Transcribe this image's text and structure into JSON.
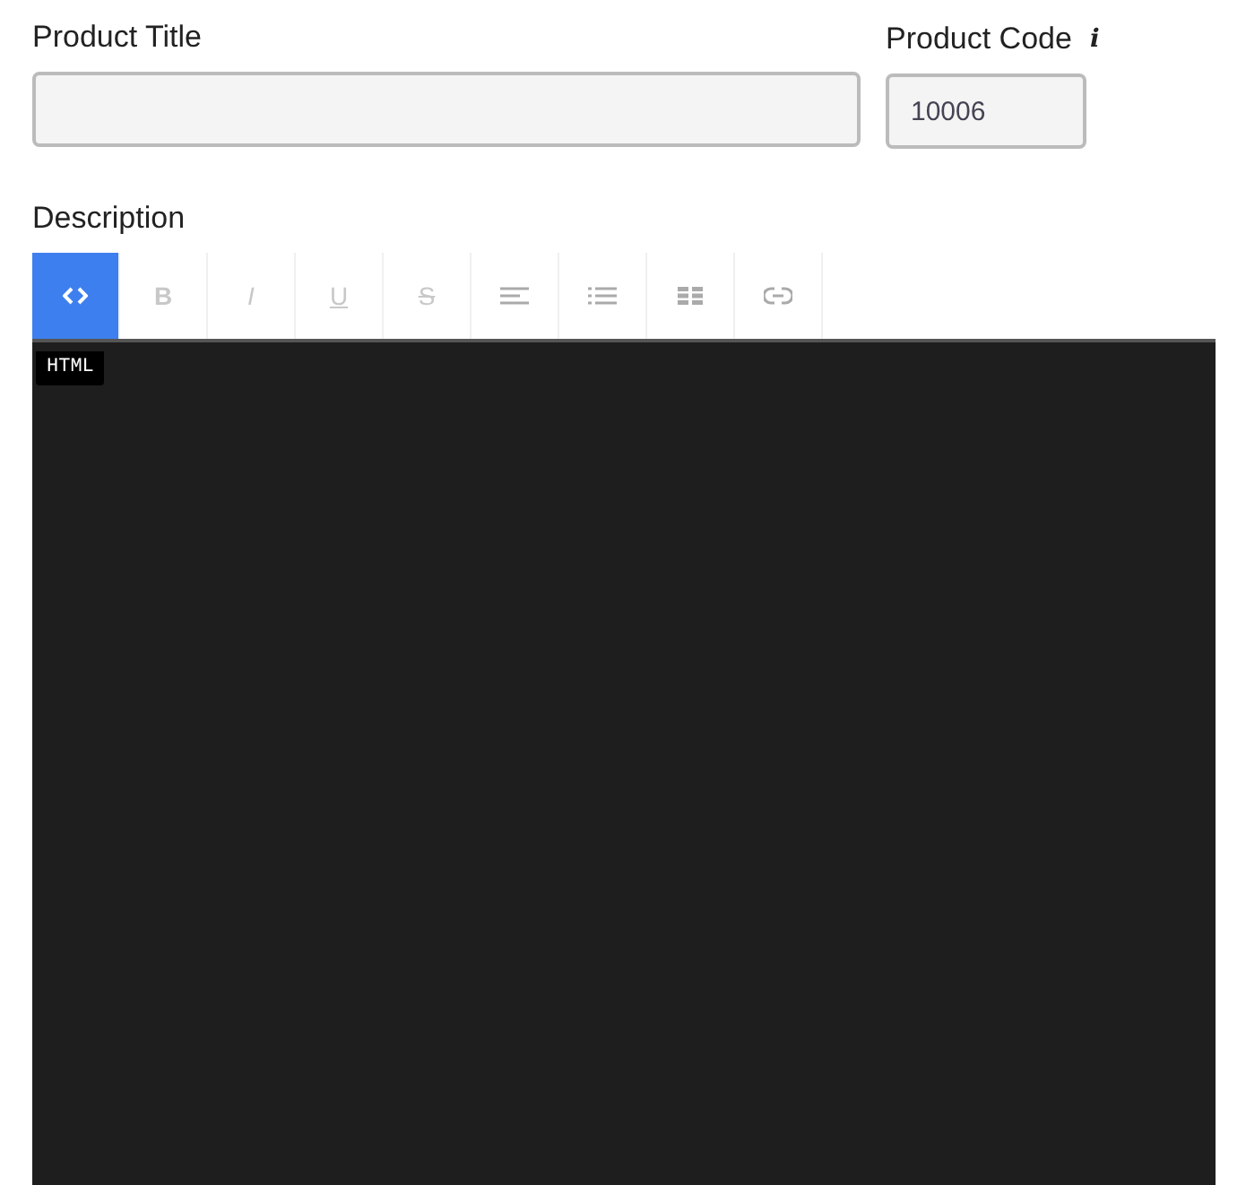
{
  "product_title": {
    "label": "Product Title"
  },
  "product_code": {
    "label": "Product Code",
    "info_icon": "i",
    "value": "10006"
  },
  "description": {
    "label": "Description",
    "toolbar": [
      {
        "kind": "code",
        "selected": true,
        "disabled": false
      },
      {
        "kind": "bold",
        "label": "B",
        "selected": false,
        "disabled": true
      },
      {
        "kind": "italic",
        "label": "I",
        "selected": false,
        "disabled": true
      },
      {
        "kind": "underline",
        "label": "U",
        "selected": false,
        "disabled": true
      },
      {
        "kind": "strike",
        "label": "S",
        "selected": false,
        "disabled": true
      },
      {
        "kind": "align",
        "selected": false,
        "disabled": false
      },
      {
        "kind": "list",
        "selected": false,
        "disabled": false
      },
      {
        "kind": "table",
        "selected": false,
        "disabled": false
      },
      {
        "kind": "link",
        "selected": false,
        "disabled": false
      }
    ],
    "editor": {
      "mode_badge": "HTML"
    }
  }
}
